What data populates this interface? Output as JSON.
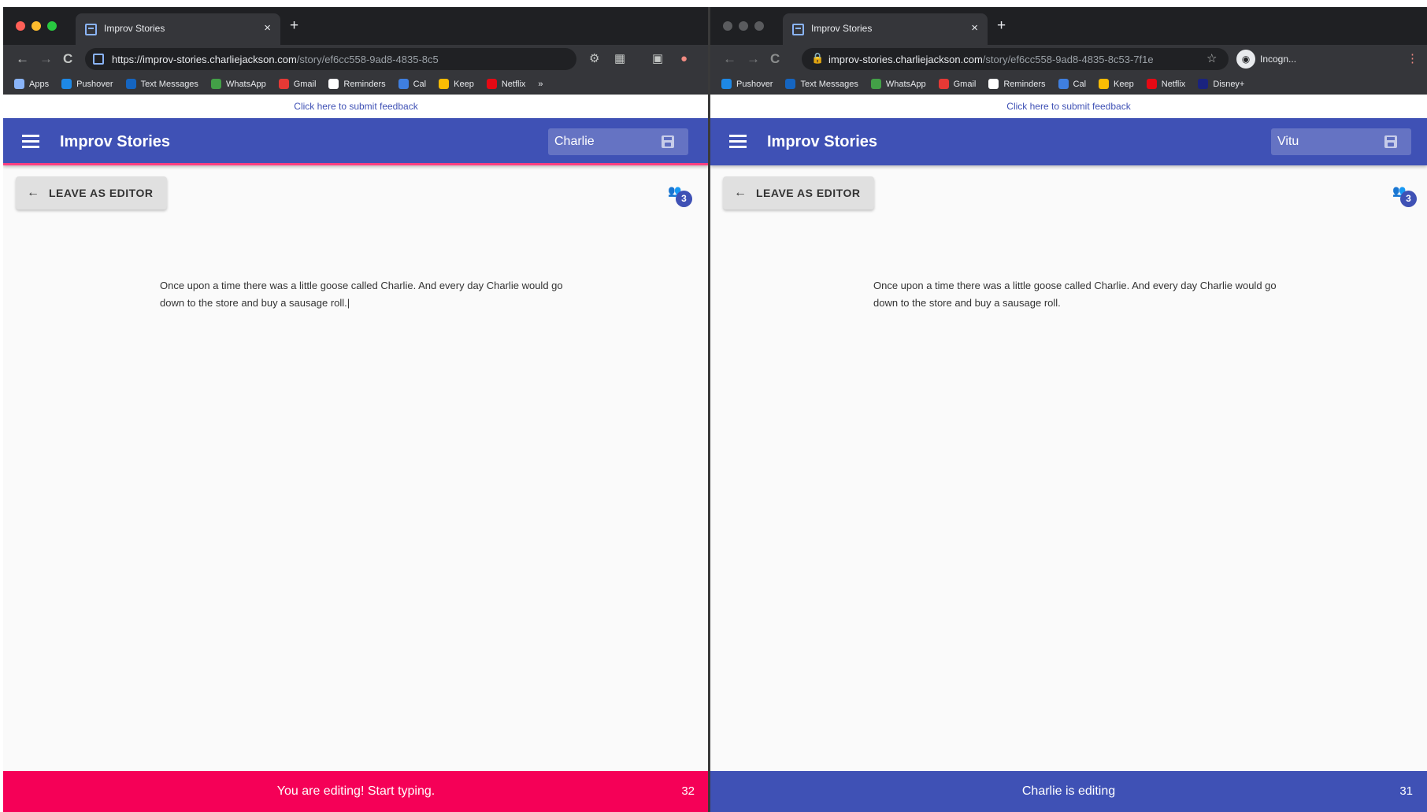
{
  "left": {
    "tab": {
      "title": "Improv Stories",
      "close": "×",
      "new_tab": "+"
    },
    "toolbar": {
      "back": "←",
      "forward": "→",
      "reload": "C",
      "url_host": "https://improv-stories.charliejackson.com",
      "url_path": "/story/ef6cc558-9ad8-4835-8c5",
      "right_icons": [
        "⚙",
        "▦",
        "▣",
        "●"
      ]
    },
    "bookmarks": [
      {
        "label": "Apps",
        "color": "#8ab4f8"
      },
      {
        "label": "Pushover",
        "color": "#1e88e5"
      },
      {
        "label": "Text Messages",
        "color": "#1565c0"
      },
      {
        "label": "WhatsApp",
        "color": "#43a047"
      },
      {
        "label": "Gmail",
        "color": "#e53935"
      },
      {
        "label": "Reminders",
        "color": "#ffffff"
      },
      {
        "label": "Cal",
        "color": "#3f7fe0"
      },
      {
        "label": "Keep",
        "color": "#fbbc04"
      },
      {
        "label": "Netflix",
        "color": "#e50914"
      }
    ],
    "bookmarks_more": "»",
    "feedback": "Click here to submit feedback",
    "app_title": "Improv Stories",
    "name_value": "Charlie",
    "leave_arrow": "←",
    "leave_label": "LEAVE AS EDITOR",
    "users_icon": "👥",
    "users_count": "3",
    "story": "Once upon a time there was a little goose called Charlie. And every day Charlie would go down to the store and buy a sausage roll.|",
    "status_text": "You are editing! Start typing.",
    "status_count": "32",
    "status_color": "#f50057"
  },
  "right": {
    "tab": {
      "title": "Improv Stories",
      "close": "×",
      "new_tab": "+"
    },
    "toolbar": {
      "back": "←",
      "forward": "→",
      "reload": "C",
      "url_host": "improv-stories.charliejackson.com",
      "url_path": "/story/ef6cc558-9ad8-4835-8c53-7f1e",
      "star": "☆",
      "incognito": "Incogn...",
      "menu": "⋮"
    },
    "bookmarks": [
      {
        "label": "Pushover",
        "color": "#1e88e5"
      },
      {
        "label": "Text Messages",
        "color": "#1565c0"
      },
      {
        "label": "WhatsApp",
        "color": "#43a047"
      },
      {
        "label": "Gmail",
        "color": "#e53935"
      },
      {
        "label": "Reminders",
        "color": "#ffffff"
      },
      {
        "label": "Cal",
        "color": "#3f7fe0"
      },
      {
        "label": "Keep",
        "color": "#fbbc04"
      },
      {
        "label": "Netflix",
        "color": "#e50914"
      },
      {
        "label": "Disney+",
        "color": "#1a237e"
      }
    ],
    "feedback": "Click here to submit feedback",
    "app_title": "Improv Stories",
    "name_value": "Vitu",
    "leave_arrow": "←",
    "leave_label": "LEAVE AS EDITOR",
    "users_icon": "👥",
    "users_count": "3",
    "story": "Once upon a time there was a little goose called Charlie. And every day Charlie would go down to the store and buy a sausage roll.",
    "status_text": "Charlie is editing",
    "status_count": "31",
    "status_color": "#3f51b5"
  },
  "traffic_lights": {
    "close": "#ff5f57",
    "minimize": "#febc2e",
    "maximize": "#28c840",
    "inactive": "#5a5b5e"
  }
}
